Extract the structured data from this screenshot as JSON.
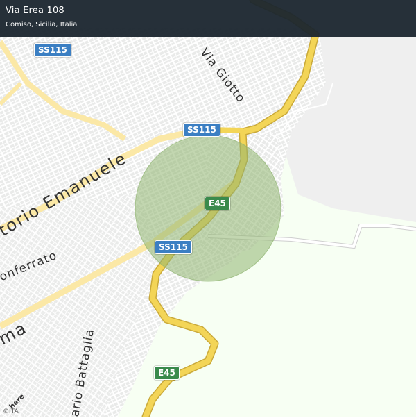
{
  "header": {
    "title": "Via Erea 108",
    "subtitle": "Comiso, Sicilia, Italia"
  },
  "shields": {
    "ss115_top": "SS115",
    "ss115_mid": "SS115",
    "ss115_low": "SS115",
    "e45_mid": "E45",
    "e45_low": "E45"
  },
  "streets": {
    "via_giotto": "Via Giotto",
    "vittorio_emanuele": "torio Emanuele",
    "monferrato": "onferrato",
    "roma": "ma",
    "battaglia": "ario Battaglia"
  },
  "attribution": {
    "copyright": "©ITA",
    "logo": "here"
  },
  "colors": {
    "background": "#f7fff3",
    "urban": "#ecedec",
    "roads_minor": "#ffffff",
    "roads_major": "#fbe8a6",
    "highway": "#f3d557",
    "accuracy_circle": "#8fb46f",
    "shield_ss": "#3b7fc3",
    "shield_e": "#3a8a4c",
    "header_bg": "#1a252e"
  }
}
